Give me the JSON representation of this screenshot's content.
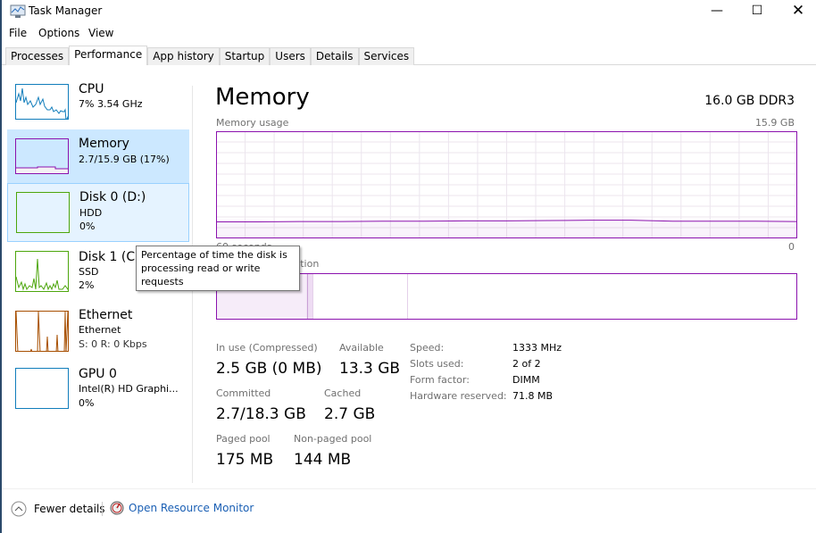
{
  "window": {
    "title": "Task Manager",
    "icon": "task-manager-icon"
  },
  "menu": [
    "File",
    "Options",
    "View"
  ],
  "tabs": [
    {
      "label": "Processes"
    },
    {
      "label": "Performance",
      "active": true
    },
    {
      "label": "App history"
    },
    {
      "label": "Startup"
    },
    {
      "label": "Users"
    },
    {
      "label": "Details"
    },
    {
      "label": "Services"
    }
  ],
  "sidebar": [
    {
      "name": "CPU",
      "line1": "7% 3.54 GHz",
      "line2": "",
      "color": "#117dbb"
    },
    {
      "name": "Memory",
      "line1": "2.7/15.9 GB (17%)",
      "line2": "",
      "color": "#8b12ae",
      "selected": true
    },
    {
      "name": "Disk 0 (D:)",
      "line1": "HDD",
      "line2": "0%",
      "color": "#4da60c",
      "hovered": true
    },
    {
      "name": "Disk 1 (C:)",
      "line1": "SSD",
      "line2": "2%",
      "color": "#4da60c"
    },
    {
      "name": "Ethernet",
      "line1": "Ethernet",
      "line2": "S: 0 R: 0 Kbps",
      "color": "#a74f01"
    },
    {
      "name": "GPU 0",
      "line1": "Intel(R) HD Graphi...",
      "line2": "0%",
      "color": "#117dbb"
    }
  ],
  "tooltip": "Percentage of time the disk is processing read or write requests",
  "main": {
    "title": "Memory",
    "spec": "16.0 GB DDR3",
    "usage_label": "Memory usage",
    "usage_max": "15.9 GB",
    "time_label": "60 seconds",
    "min_label": "0",
    "composition_label": "Memory composition",
    "usage_series_gb": [
      2.45,
      2.45,
      2.5,
      2.5,
      2.55,
      2.55,
      2.6,
      2.6,
      2.65,
      2.7,
      2.7,
      2.55,
      2.55,
      2.55,
      2.5
    ],
    "composition_gb": {
      "in_use": 2.5,
      "modified": 0.15,
      "standby": 2.6,
      "free": 10.65
    },
    "accent": "#8b12ae",
    "stats": [
      {
        "label": "In use (Compressed)",
        "value": "2.5 GB (0 MB)"
      },
      {
        "label": "Available",
        "value": "13.3 GB"
      },
      {
        "label": "Committed",
        "value": "2.7/18.3 GB"
      },
      {
        "label": "Cached",
        "value": "2.7 GB"
      },
      {
        "label": "Paged pool",
        "value": "175 MB"
      },
      {
        "label": "Non-paged pool",
        "value": "144 MB"
      }
    ],
    "details": [
      {
        "label": "Speed:",
        "value": "1333 MHz"
      },
      {
        "label": "Slots used:",
        "value": "2 of 2"
      },
      {
        "label": "Form factor:",
        "value": "DIMM"
      },
      {
        "label": "Hardware reserved:",
        "value": "71.8 MB"
      }
    ]
  },
  "footer": {
    "fewer": "Fewer details",
    "monitor": "Open Resource Monitor"
  }
}
